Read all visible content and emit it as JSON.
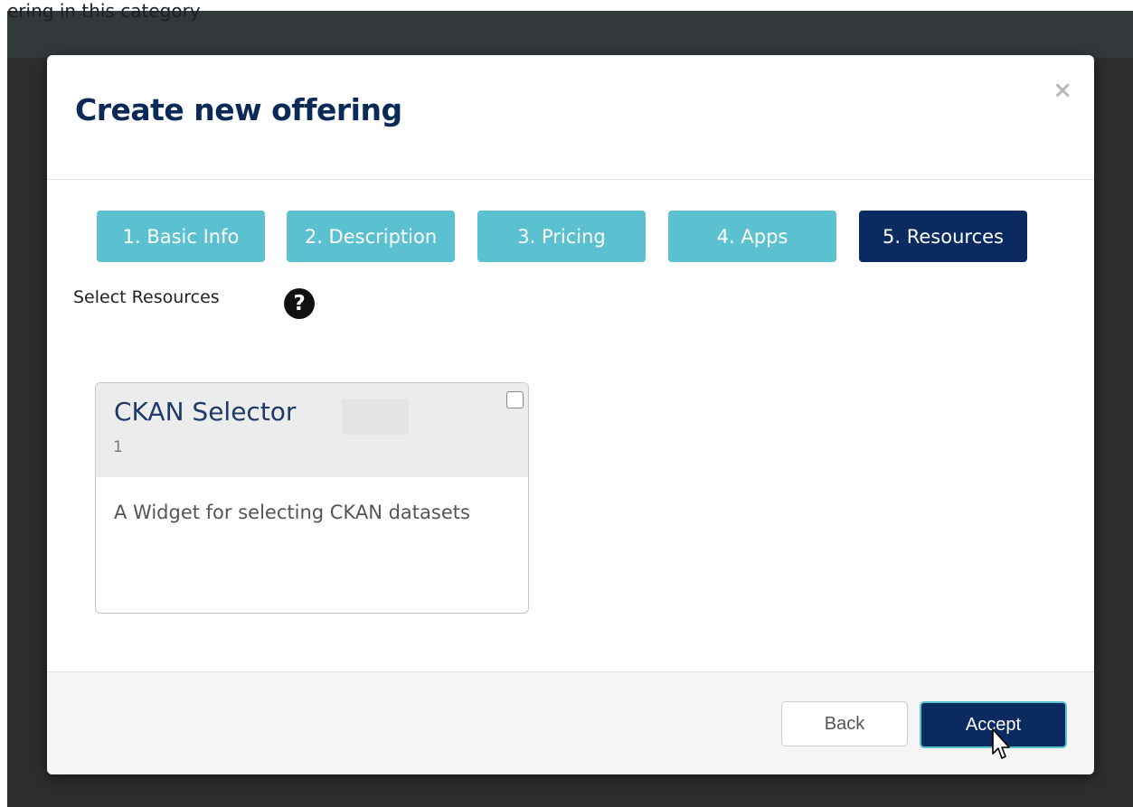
{
  "background": {
    "text": "ering in this category"
  },
  "modal": {
    "title": "Create new offering",
    "close_symbol": "×"
  },
  "steps": [
    {
      "label": "1. Basic Info",
      "active": false
    },
    {
      "label": "2. Description",
      "active": false
    },
    {
      "label": "3. Pricing",
      "active": false
    },
    {
      "label": "4. Apps",
      "active": false
    },
    {
      "label": "5. Resources",
      "active": true
    }
  ],
  "resources": {
    "label": "Select Resources",
    "help_symbol": "?",
    "items": [
      {
        "name": "CKAN Selector",
        "version": "1",
        "description": "A Widget for selecting CKAN datasets",
        "checked": false
      }
    ]
  },
  "footer": {
    "back_label": "Back",
    "accept_label": "Accept"
  },
  "colors": {
    "accent": "#5bc0cf",
    "brand_dark": "#0b2a5f",
    "title": "#0b2a57",
    "overlay": "#2b2d2e"
  },
  "icons": {
    "close": "close-icon",
    "help": "question-circle-icon",
    "cursor": "mouse-pointer-icon"
  }
}
